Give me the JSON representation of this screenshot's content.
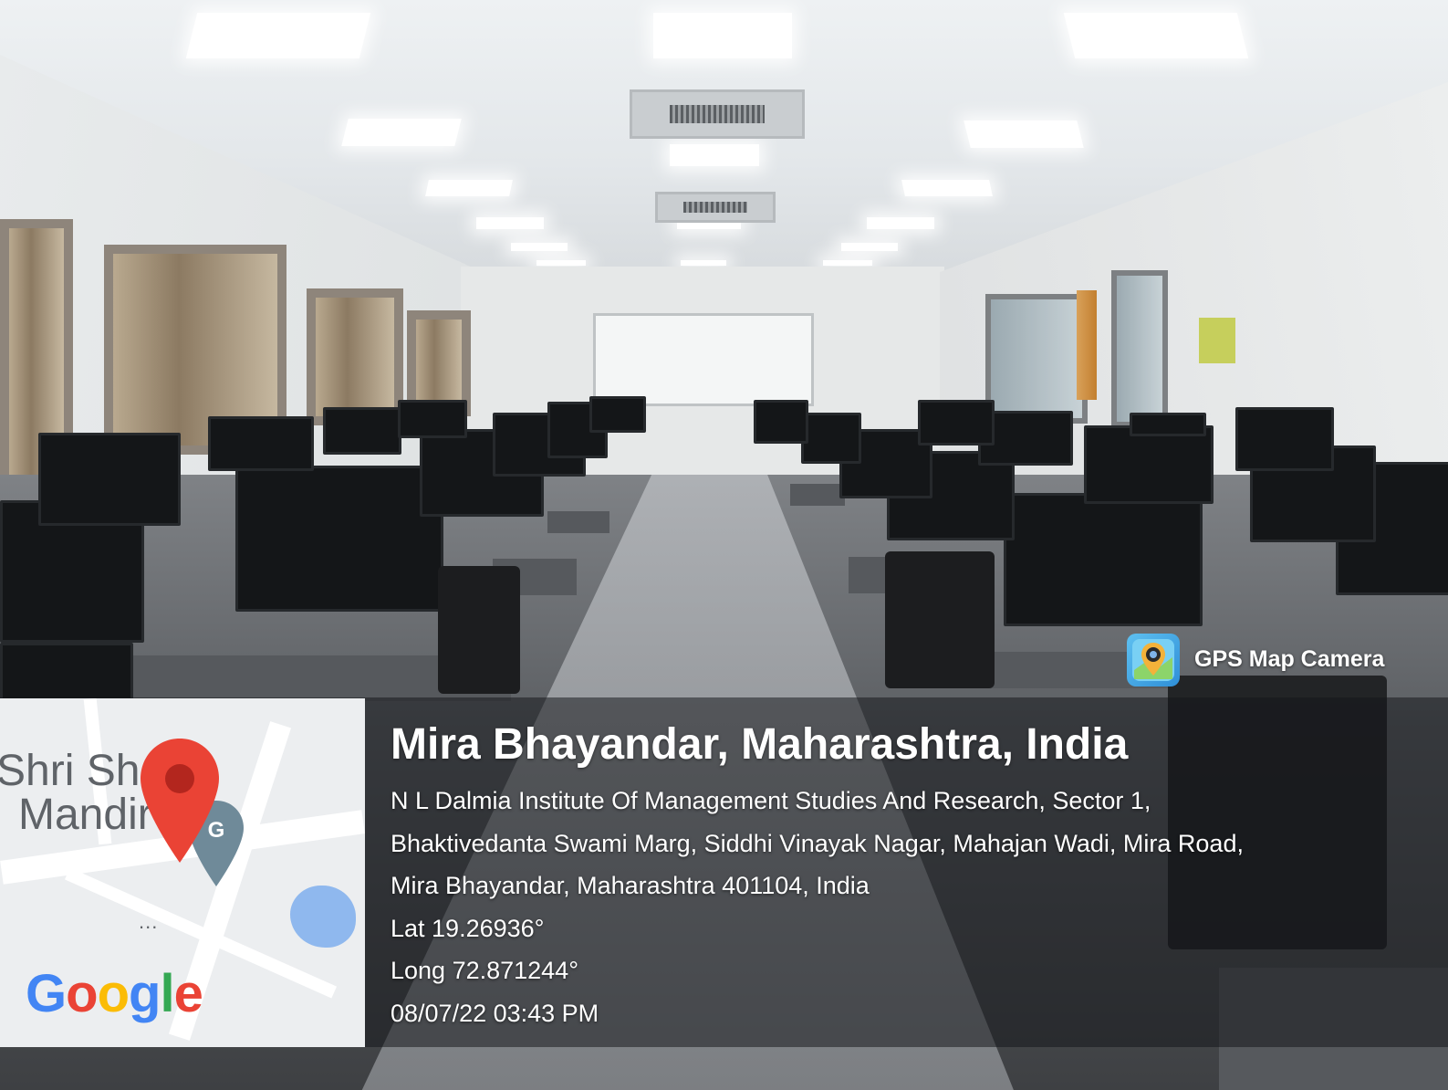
{
  "map": {
    "place_label_line1": "Shri Sh",
    "place_label_line2": "Mandir",
    "more_dots": "...",
    "logo_letters": [
      "G",
      "o",
      "o",
      "g",
      "l",
      "e"
    ]
  },
  "badge": {
    "app_name": "GPS Map Camera",
    "icon": "gps-map-camera-icon"
  },
  "location": {
    "title": "Mira Bhayandar, Maharashtra, India",
    "address_lines": [
      "N L Dalmia Institute Of Management Studies And Research, Sector 1,",
      "Bhaktivedanta Swami Marg, Siddhi Vinayak Nagar, Mahajan Wadi, Mira Road,",
      "Mira Bhayandar, Maharashtra 401104, India"
    ],
    "lat": "Lat 19.26936°",
    "long": "Long 72.871244°",
    "datetime": "08/07/22 03:43 PM"
  },
  "colors": {
    "pin_red": "#ea4335",
    "pin_dark": "#b3261e",
    "map_water": "#8fb8ee"
  }
}
